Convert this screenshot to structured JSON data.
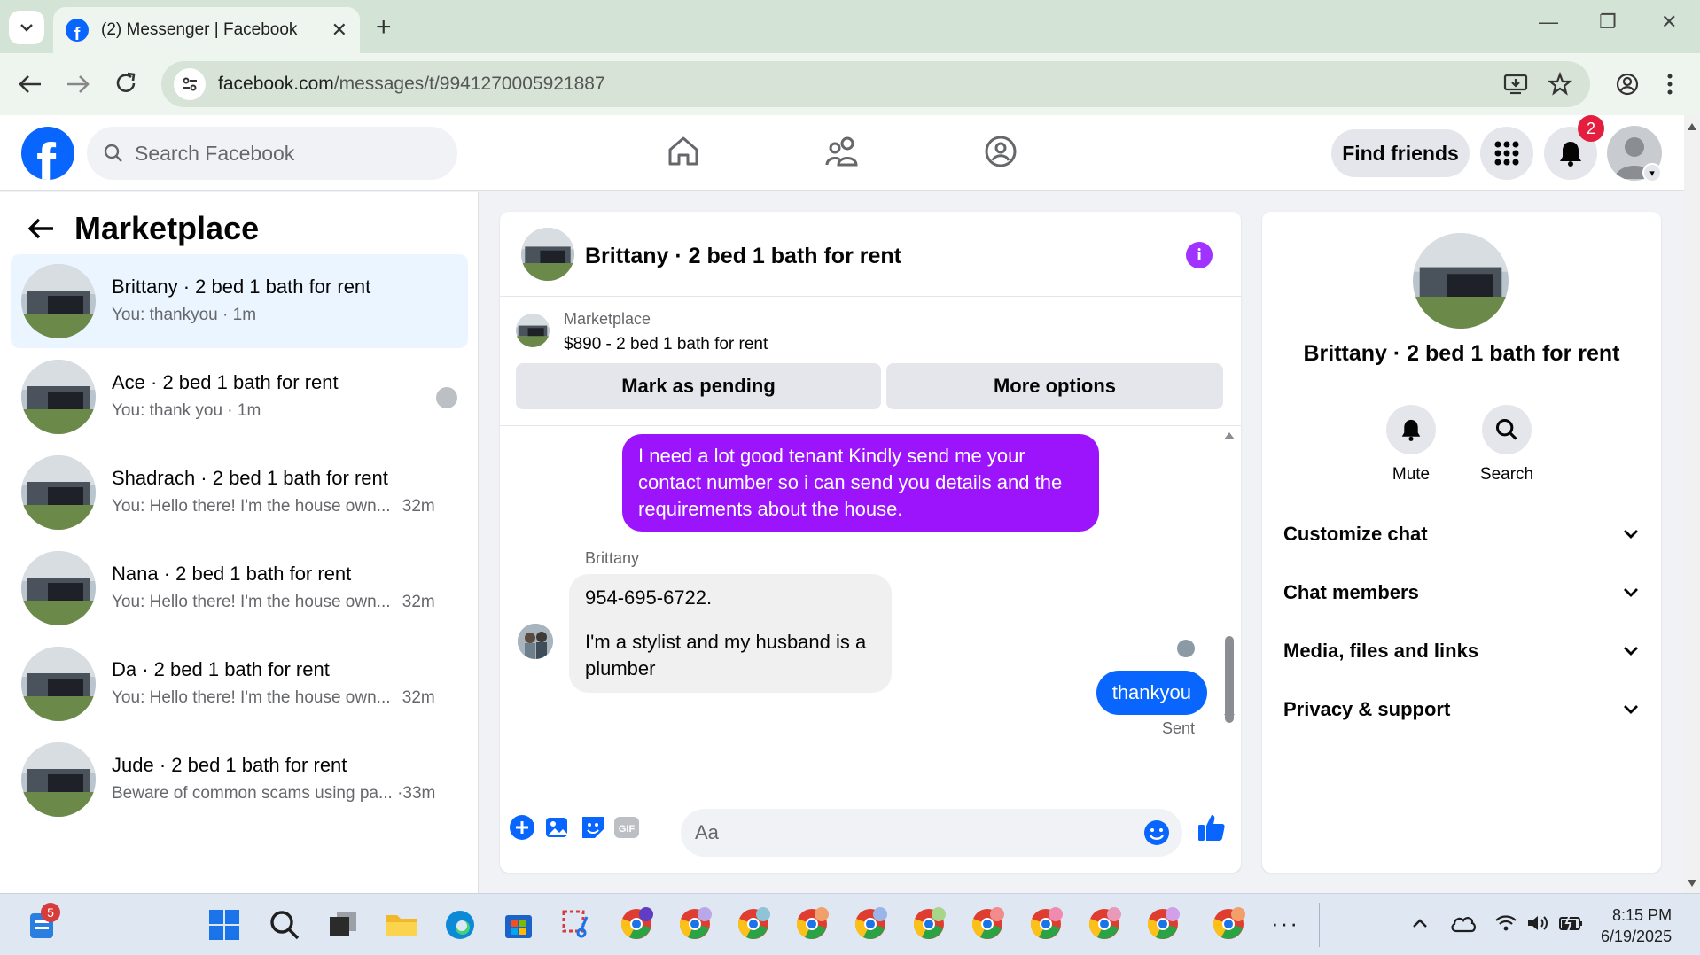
{
  "browser": {
    "tab_title": "(2) Messenger | Facebook",
    "url_host": "facebook.com",
    "url_path": "/messages/t/9941270005921887",
    "colors": {
      "chrome_bg": "#d3e3d5",
      "toolbar_bg": "#eef5ef"
    }
  },
  "header": {
    "search_placeholder": "Search Facebook",
    "find_friends_label": "Find friends",
    "notification_count": "2",
    "nav_icons": [
      "home-icon",
      "friends-icon",
      "groups-icon"
    ]
  },
  "sidebar": {
    "title": "Marketplace",
    "conversations": [
      {
        "name": "Brittany · 2 bed 1 bath for rent",
        "snippet": "You: thankyou",
        "time": "1m",
        "active": true
      },
      {
        "name": "Ace · 2 bed 1 bath for rent",
        "snippet": "You: thank you",
        "time": "1m",
        "active": false
      },
      {
        "name": "Shadrach · 2 bed 1 bath for rent",
        "snippet": "You: Hello there! I'm the house own...",
        "time": "32m",
        "active": false
      },
      {
        "name": "Nana · 2 bed 1 bath for rent",
        "snippet": "You: Hello there! I'm the house own...",
        "time": "32m",
        "active": false
      },
      {
        "name": "Da · 2 bed 1 bath for rent",
        "snippet": "You: Hello there! I'm the house own...",
        "time": "32m",
        "active": false
      },
      {
        "name": "Jude · 2 bed 1 bath for rent",
        "snippet": "Beware of common scams using pa...",
        "time": "33m",
        "active": false
      }
    ]
  },
  "chat": {
    "title": "Brittany · 2 bed 1 bath for rent",
    "listing_label": "Marketplace",
    "listing_price": "$890 - 2 bed 1 bath for rent",
    "mark_pending_label": "Mark as pending",
    "more_options_label": "More options",
    "outgoing_message": "I need a lot good tenant Kindly send me your contact number so i can send you details and the requirements about the house.",
    "sender_name": "Brittany",
    "incoming_line1": "954-695-6722.",
    "incoming_line2": "I'm a stylist and my husband is a plumber",
    "sent_message": "thankyou",
    "sent_status": "Sent",
    "composer_placeholder": "Aa",
    "colors": {
      "outgoing": "#9c14fc",
      "sent": "#0866ff",
      "info": "#a033ff"
    }
  },
  "details": {
    "name": "Brittany · 2 bed 1 bath for rent",
    "mute_label": "Mute",
    "search_label": "Search",
    "sections": [
      "Customize chat",
      "Chat members",
      "Media, files and links",
      "Privacy & support"
    ]
  },
  "taskbar": {
    "badge_count": "5",
    "time": "8:15 PM",
    "date": "6/19/2025"
  }
}
